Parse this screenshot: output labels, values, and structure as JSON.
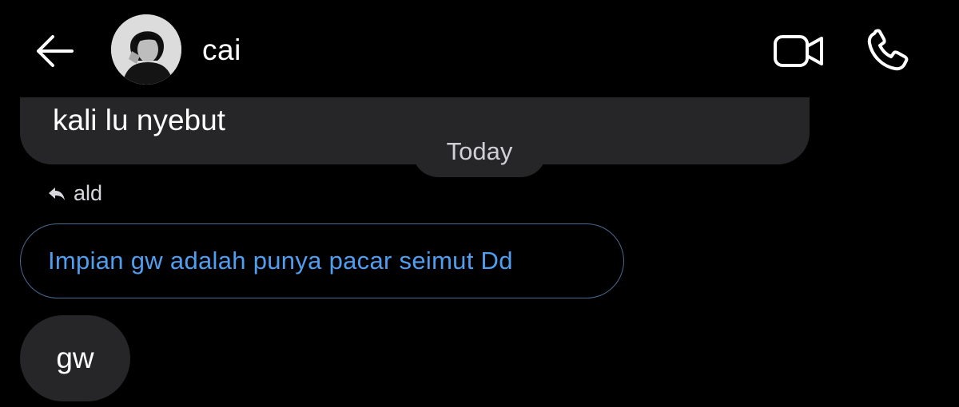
{
  "header": {
    "contact_name": "cai",
    "back_icon": "arrow-left-icon",
    "video_icon": "video-camera-icon",
    "call_icon": "phone-icon"
  },
  "messages": {
    "partial_received_text": "kali lu nyebut",
    "date_separator": "Today",
    "reply_label": "ald",
    "quoted_text": "Impian gw adalah punya pacar seimut Dd",
    "received_text": "gw"
  },
  "colors": {
    "background": "#000000",
    "bubble": "#262628",
    "quote_text": "#4f9ef0",
    "quote_border": "#4a6a90"
  }
}
